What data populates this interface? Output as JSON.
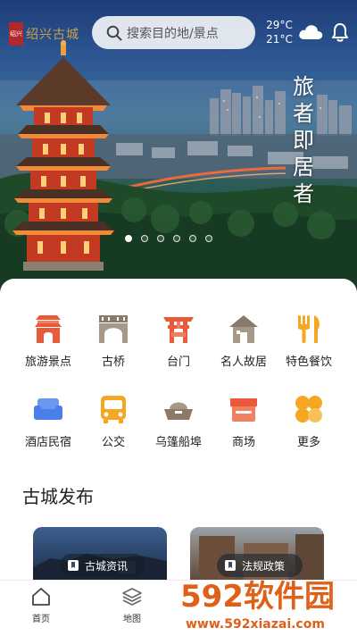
{
  "app": {
    "logo_text": "绍兴古城",
    "logo_seal": "绍兴"
  },
  "search": {
    "placeholder": "搜索目的地/景点"
  },
  "weather": {
    "high": "29°C",
    "low": "21°C",
    "icon": "cloud-icon"
  },
  "hero": {
    "tagline": [
      "旅",
      "者",
      "即",
      "居",
      "者"
    ],
    "slide_count": 6,
    "active_slide": 1
  },
  "categories": [
    {
      "label": "旅游景点",
      "icon": "scenic-gate-icon",
      "color": "#e85a3a"
    },
    {
      "label": "古桥",
      "icon": "bridge-icon",
      "color": "#8a7a6a"
    },
    {
      "label": "台门",
      "icon": "torii-gate-icon",
      "color": "#e85a3a"
    },
    {
      "label": "名人故居",
      "icon": "house-icon",
      "color": "#8a7a6a"
    },
    {
      "label": "特色餐饮",
      "icon": "fork-knife-icon",
      "color": "#f5a623"
    },
    {
      "label": "酒店民宿",
      "icon": "sofa-icon",
      "color": "#4a7ee8"
    },
    {
      "label": "公交",
      "icon": "bus-icon",
      "color": "#f5a623"
    },
    {
      "label": "乌篷船埠",
      "icon": "boat-icon",
      "color": "#8a7a6a"
    },
    {
      "label": "商场",
      "icon": "shop-icon",
      "color": "#e85a3a"
    },
    {
      "label": "更多",
      "icon": "more-icon",
      "color": "#f5a623"
    }
  ],
  "section": {
    "title": "古城发布"
  },
  "news": [
    {
      "label": "古城资讯"
    },
    {
      "label": "法规政策"
    }
  ],
  "nav": [
    {
      "label": "首页",
      "icon": "home-icon",
      "active": true
    },
    {
      "label": "地图",
      "icon": "map-layers-icon",
      "active": false
    }
  ],
  "watermark": {
    "brand": "592软件园",
    "url": "www.592xiazai.com"
  }
}
